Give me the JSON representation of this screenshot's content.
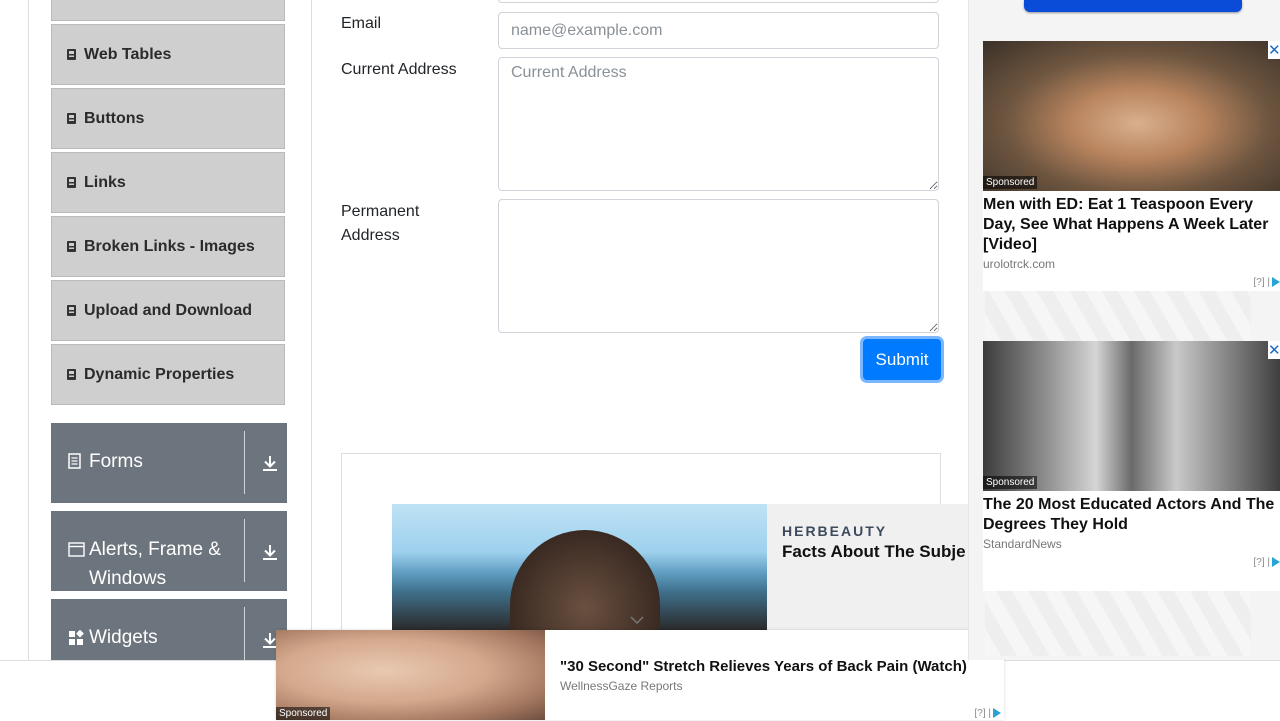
{
  "sidebar": {
    "items": [
      {
        "label": "Web Tables"
      },
      {
        "label": "Buttons"
      },
      {
        "label": "Links"
      },
      {
        "label": "Broken Links - Images"
      },
      {
        "label": "Upload and Download"
      },
      {
        "label": "Dynamic Properties"
      }
    ],
    "groups": [
      {
        "label": "Forms",
        "icon": "form-icon"
      },
      {
        "label": "Alerts, Frame &",
        "label2": "Windows",
        "icon": "window-icon"
      },
      {
        "label": "Widgets",
        "icon": "widgets-icon"
      }
    ]
  },
  "form": {
    "email_label": "Email",
    "email_placeholder": "name@example.com",
    "current_address_label": "Current Address",
    "current_address_placeholder": "Current Address",
    "permanent_address_label_1": "Permanent",
    "permanent_address_label_2": "Address",
    "submit_label": "Submit"
  },
  "mid_ad": {
    "brand": "HERBEAUTY",
    "headline": "Facts About The Subje"
  },
  "bottom_ad": {
    "sponsored": "Sponsored",
    "title": "\"30 Second\" Stretch Relieves Years of Back Pain (Watch)",
    "source": "WellnessGaze Reports",
    "adchoice": "[?]"
  },
  "right_ads": [
    {
      "sponsored": "Sponsored",
      "title": "Men with ED: Eat 1 Teaspoon Every Day, See What Happens A Week Later [Video]",
      "source": "urolotrck.com",
      "adchoice": "[?]"
    },
    {
      "sponsored": "Sponsored",
      "title": "The 20 Most Educated Actors And The Degrees They Hold",
      "source": "StandardNews",
      "adchoice": "[?]"
    }
  ],
  "colors": {
    "primary": "#007bff",
    "group_bg": "#6c757d",
    "menu_bg": "#cfcfcf"
  }
}
